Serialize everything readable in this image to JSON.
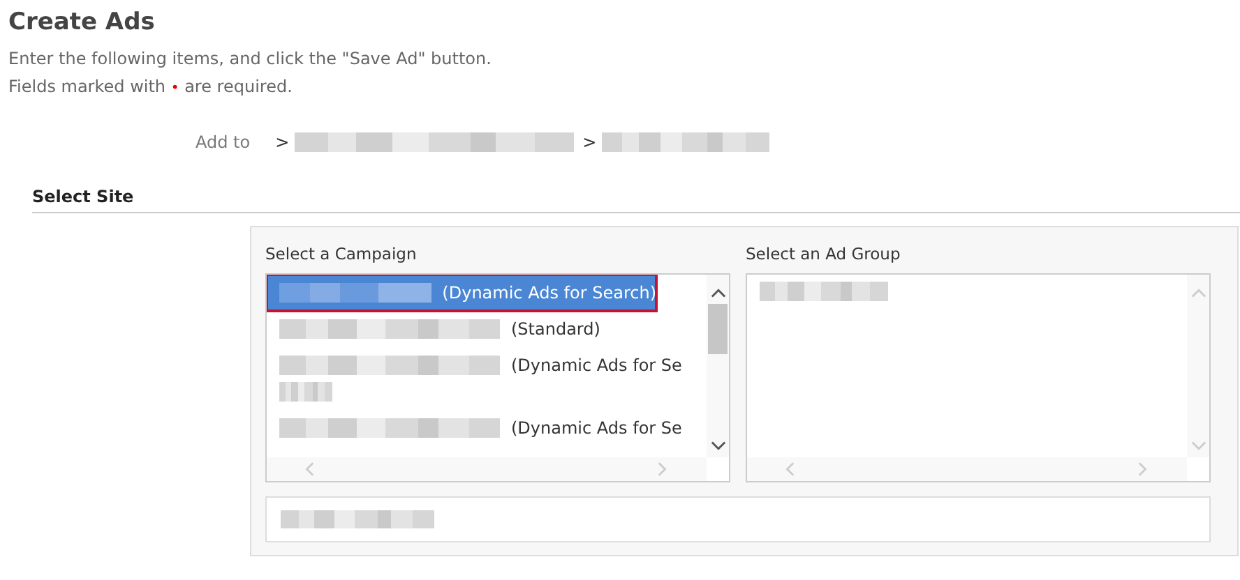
{
  "page": {
    "title": "Create Ads",
    "instructions": "Enter the following items, and click the \"Save Ad\" button.",
    "required_note": {
      "before": "Fields marked with",
      "marker": "•",
      "after": "are required."
    }
  },
  "breadcrumb": {
    "label": "Add to",
    "steps": [
      {
        "separator": ">",
        "kind": "redacted"
      },
      {
        "separator": ">",
        "kind": "redacted"
      }
    ]
  },
  "section": {
    "title": "Select Site"
  },
  "campaign_list": {
    "heading": "Select a Campaign",
    "scrollable": true,
    "items": [
      {
        "kind": "redacted",
        "label": "(Dynamic Ads for Search)",
        "selected": true,
        "extra_line": false
      },
      {
        "kind": "redacted",
        "label": "(Standard)",
        "selected": false,
        "extra_line": false
      },
      {
        "kind": "redacted",
        "label": "(Dynamic Ads for Se",
        "selected": false,
        "extra_line": true
      },
      {
        "kind": "redacted",
        "label": "(Dynamic Ads for Se",
        "selected": false,
        "extra_line": false
      }
    ]
  },
  "ad_group_list": {
    "heading": "Select an Ad Group",
    "scrollable": false,
    "items": [
      {
        "kind": "redacted",
        "selected": false
      }
    ]
  },
  "selection_field": {
    "kind": "redacted"
  }
}
